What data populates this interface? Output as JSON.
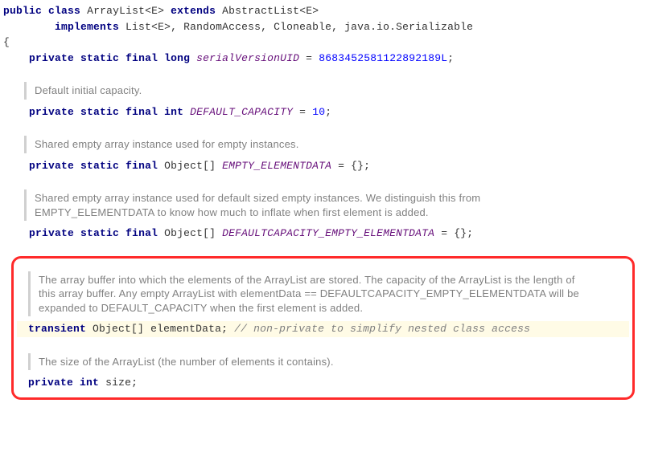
{
  "decl": {
    "line1": {
      "kw_public": "public",
      "kw_class": "class",
      "name": "ArrayList",
      "generic_open": "<",
      "generic_param": "E",
      "generic_close": ">",
      "kw_extends": "extends",
      "super": "AbstractList",
      "super_generic": "<E>"
    },
    "line2": {
      "kw_implements": "implements",
      "iface1": "List",
      "iface1_generic": "<E>",
      "sep1": ", ",
      "iface2": "RandomAccess",
      "sep2": ", ",
      "iface3": "Cloneable",
      "sep3": ", ",
      "iface4": "java.io.Serializable"
    },
    "brace_open": "{"
  },
  "svuid": {
    "kw_private": "private",
    "kw_static": "static",
    "kw_final": "final",
    "kw_long": "long",
    "name": "serialVersionUID",
    "eq": " = ",
    "value": "8683452581122892189L",
    "semi": ";"
  },
  "doc_default_capacity": "Default initial capacity.",
  "default_capacity": {
    "kw_private": "private",
    "kw_static": "static",
    "kw_final": "final",
    "kw_int": "int",
    "name": "DEFAULT_CAPACITY",
    "eq": " = ",
    "value": "10",
    "semi": ";"
  },
  "doc_empty": "Shared empty array instance used for empty instances.",
  "empty_elementdata": {
    "kw_private": "private",
    "kw_static": "static",
    "kw_final": "final",
    "type": "Object[]",
    "name": "EMPTY_ELEMENTDATA",
    "rest": " = {};"
  },
  "doc_defcap_empty": "Shared empty array instance used for default sized empty instances. We distinguish this from EMPTY_ELEMENTDATA to know how much to inflate when first element is added.",
  "defcap_empty": {
    "kw_private": "private",
    "kw_static": "static",
    "kw_final": "final",
    "type": "Object[]",
    "name": "DEFAULTCAPACITY_EMPTY_ELEMENTDATA",
    "rest": " = {};"
  },
  "doc_elementdata": "The array buffer into which the elements of the ArrayList are stored. The capacity of the ArrayList is the length of this array buffer. Any empty ArrayList with elementData == DEFAULTCAPACITY_EMPTY_ELEMENTDATA will be expanded to DEFAULT_CAPACITY when the first element is added.",
  "elementdata": {
    "kw_transient": "transient",
    "type": "Object[]",
    "name": "elementData",
    "semi": ";",
    "comment": " // non-private to simplify nested class access"
  },
  "doc_size": "The size of the ArrayList (the number of elements it contains).",
  "size_field": {
    "kw_private": "private",
    "kw_int": "int",
    "name": "size",
    "semi": ";"
  }
}
